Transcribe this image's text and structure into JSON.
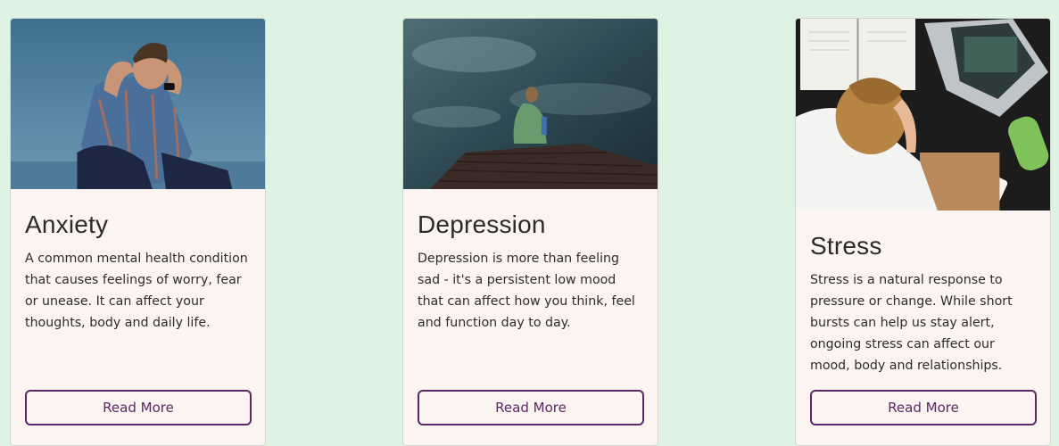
{
  "colors": {
    "page_background": "#dff3e2",
    "card_background": "#fcf4f1",
    "button_accent": "#5b2767",
    "text": "#2c2c2c"
  },
  "cards": [
    {
      "title": "Anxiety",
      "description": "A common mental health condition that causes feelings of worry, fear or unease. It can affect your thoughts, body and daily life.",
      "button_label": "Read More",
      "image_subject": "man-holding-head-by-sea"
    },
    {
      "title": "Depression",
      "description": "Depression is more than feeling sad - it's a persistent low mood that can affect how you think, feel and function day to day.",
      "button_label": "Read More",
      "image_subject": "woman-sitting-on-dock"
    },
    {
      "title": "Stress",
      "description": "Stress is a natural response to pressure or change. While short bursts can help us stay alert, ongoing stress can affect our mood, body and relationships.",
      "button_label": "Read More",
      "image_subject": "woman-at-desk-with-laptop"
    }
  ]
}
